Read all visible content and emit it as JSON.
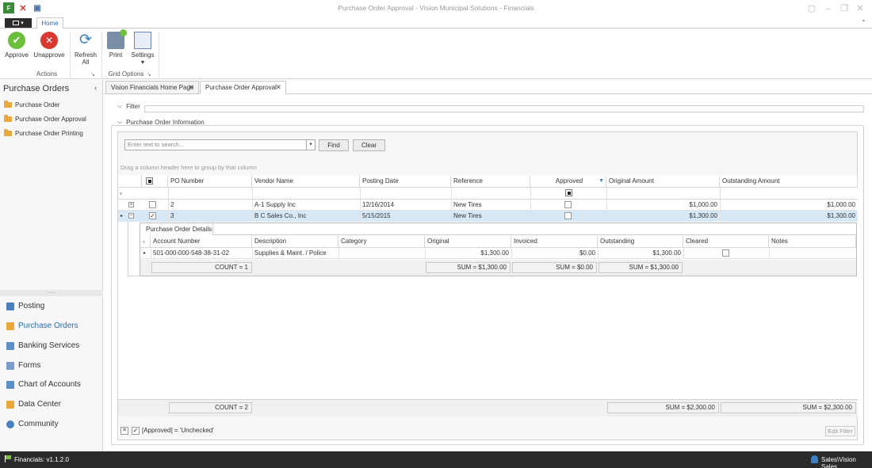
{
  "app": {
    "title": "Purchase Order Approval - Vision Municipal Solutions - Financials",
    "home_tab": "Home"
  },
  "ribbon": {
    "approve": "Approve",
    "unapprove": "Unapprove",
    "refresh": "Refresh",
    "refresh2": "All",
    "print": "Print",
    "settings": "Settings",
    "group_actions": "Actions",
    "group_grid": "Grid Options"
  },
  "sidebar": {
    "title": "Purchase Orders",
    "items": [
      "Purchase Order",
      "Purchase Order Approval",
      "Purchase Order Printing"
    ],
    "nav": [
      "Posting",
      "Purchase Orders",
      "Banking Services",
      "Forms",
      "Chart of Accounts",
      "Data Center",
      "Community"
    ]
  },
  "tabs": [
    "Vision Financials Home Page",
    "Purchase Order Approval"
  ],
  "sections": {
    "filter": "Filter",
    "info": "Purchase Order Information"
  },
  "search": {
    "placeholder": "Enter text to search...",
    "find": "Find",
    "clear": "Clear",
    "group_hint": "Drag a column header here to group by that column"
  },
  "grid": {
    "columns": [
      "PO Number",
      "Vendor Name",
      "Posting Date",
      "Reference",
      "Approved",
      "Original Amount",
      "Outstanding Amount"
    ],
    "rows": [
      {
        "po": "2",
        "vendor": "A-1 Supply Inc",
        "date": "12/16/2014",
        "ref": "New Tires",
        "original": "$1,000.00",
        "outstanding": "$1,000.00"
      },
      {
        "po": "3",
        "vendor": "B C Sales Co., Inc",
        "date": "5/15/2015",
        "ref": "New Tires",
        "original": "$1,300.00",
        "outstanding": "$1,300.00"
      }
    ],
    "count": "COUNT = 2",
    "sum_original": "SUM = $2,300.00",
    "sum_outstanding": "SUM = $2,300.00"
  },
  "detail": {
    "tab": "Purchase Order Details",
    "columns": [
      "Account Number",
      "Description",
      "Category",
      "Original",
      "Invoiced",
      "Outstanding",
      "Cleared",
      "Notes"
    ],
    "row": {
      "account": "501-000-000-548-38-31-02",
      "description": "Supplies & Maint. / Police",
      "category": "",
      "original": "$1,300.00",
      "invoiced": "$0.00",
      "outstanding": "$1,300.00",
      "notes": ""
    },
    "count": "COUNT = 1",
    "sum_original": "SUM = $1,300.00",
    "sum_invoiced": "SUM = $0.00",
    "sum_outstanding": "SUM = $1,300.00"
  },
  "filter": {
    "expression": "[Approved] = 'Unchecked'",
    "edit": "Edit Filter"
  },
  "status": {
    "version": "Financials: v1.1.2.0",
    "user": "Sales\\Vision Sales"
  },
  "colors": {
    "accent": "#2a6db3",
    "selected_row": "#d6e8f6",
    "statusbar": "#2b2b2b"
  }
}
